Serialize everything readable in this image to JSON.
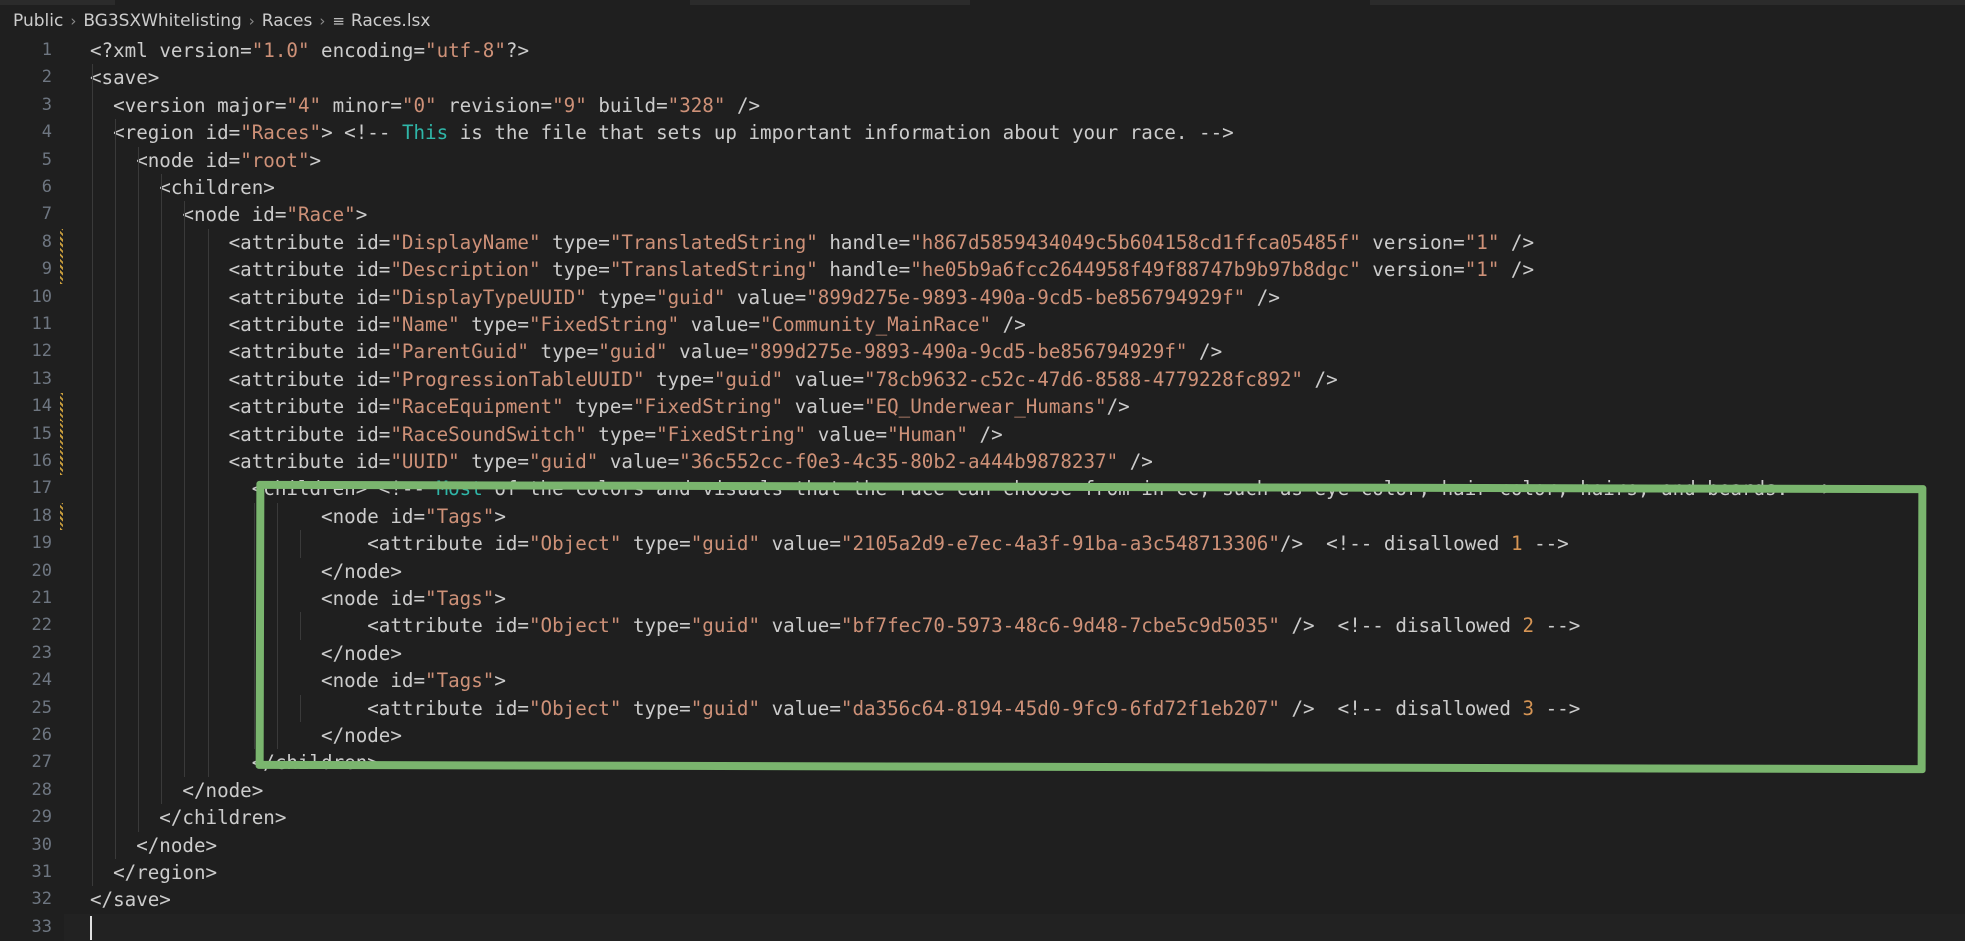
{
  "breadcrumb": {
    "items": [
      "Public",
      "BG3SXWhitelisting",
      "Races"
    ],
    "file": "Races.lsx"
  },
  "editor": {
    "lines": [
      [
        [
          "t-tag",
          "<?xml "
        ],
        [
          "t-attr",
          "version="
        ],
        [
          "t-str",
          "\"1.0\""
        ],
        [
          "t-attr",
          " encoding="
        ],
        [
          "t-str",
          "\"utf-8\""
        ],
        [
          "t-tag",
          "?>"
        ]
      ],
      [
        [
          "t-tag",
          "<save>"
        ]
      ],
      [
        [
          "t-tag",
          "  <version "
        ],
        [
          "t-attr",
          "major="
        ],
        [
          "t-str",
          "\"4\""
        ],
        [
          "t-attr",
          " minor="
        ],
        [
          "t-str",
          "\"0\""
        ],
        [
          "t-attr",
          " revision="
        ],
        [
          "t-str",
          "\"9\""
        ],
        [
          "t-attr",
          " build="
        ],
        [
          "t-str",
          "\"328\""
        ],
        [
          "t-tag",
          " />"
        ]
      ],
      [
        [
          "t-tag",
          "  <region "
        ],
        [
          "t-attr",
          "id="
        ],
        [
          "t-str",
          "\"Races\""
        ],
        [
          "t-tag",
          "> "
        ],
        [
          "t-cmtg",
          "<!-- "
        ],
        [
          "t-kw",
          "This"
        ],
        [
          "t-cmtg",
          " is the file that sets up important information about your race. -->"
        ]
      ],
      [
        [
          "t-tag",
          "    <node "
        ],
        [
          "t-attr",
          "id="
        ],
        [
          "t-str",
          "\"root\""
        ],
        [
          "t-tag",
          ">"
        ]
      ],
      [
        [
          "t-tag",
          "      <children>"
        ]
      ],
      [
        [
          "t-tag",
          "        <node "
        ],
        [
          "t-attr",
          "id="
        ],
        [
          "t-str",
          "\"Race\""
        ],
        [
          "t-tag",
          ">"
        ]
      ],
      [
        [
          "t-tag",
          "            <attribute "
        ],
        [
          "t-attr",
          "id="
        ],
        [
          "t-str",
          "\"DisplayName\""
        ],
        [
          "t-attr",
          " type="
        ],
        [
          "t-str",
          "\"TranslatedString\""
        ],
        [
          "t-attr",
          " handle="
        ],
        [
          "t-str",
          "\"h867d5859434049c5b604158cd1ffca05485f\""
        ],
        [
          "t-attr",
          " version="
        ],
        [
          "t-str",
          "\"1\""
        ],
        [
          "t-tag",
          " />"
        ]
      ],
      [
        [
          "t-tag",
          "            <attribute "
        ],
        [
          "t-attr",
          "id="
        ],
        [
          "t-str",
          "\"Description\""
        ],
        [
          "t-attr",
          " type="
        ],
        [
          "t-str",
          "\"TranslatedString\""
        ],
        [
          "t-attr",
          " handle="
        ],
        [
          "t-str",
          "\"he05b9a6fcc2644958f49f88747b9b97b8dgc\""
        ],
        [
          "t-attr",
          " version="
        ],
        [
          "t-str",
          "\"1\""
        ],
        [
          "t-tag",
          " />"
        ]
      ],
      [
        [
          "t-tag",
          "            <attribute "
        ],
        [
          "t-attr",
          "id="
        ],
        [
          "t-str",
          "\"DisplayTypeUUID\""
        ],
        [
          "t-attr",
          " type="
        ],
        [
          "t-str",
          "\"guid\""
        ],
        [
          "t-attr",
          " value="
        ],
        [
          "t-str",
          "\"899d275e-9893-490a-9cd5-be856794929f\""
        ],
        [
          "t-tag",
          " />"
        ]
      ],
      [
        [
          "t-tag",
          "            <attribute "
        ],
        [
          "t-attr",
          "id="
        ],
        [
          "t-str",
          "\"Name\""
        ],
        [
          "t-attr",
          " type="
        ],
        [
          "t-str",
          "\"FixedString\""
        ],
        [
          "t-attr",
          " value="
        ],
        [
          "t-str",
          "\"Community_MainRace\""
        ],
        [
          "t-tag",
          " />"
        ]
      ],
      [
        [
          "t-tag",
          "            <attribute "
        ],
        [
          "t-attr",
          "id="
        ],
        [
          "t-str",
          "\"ParentGuid\""
        ],
        [
          "t-attr",
          " type="
        ],
        [
          "t-str",
          "\"guid\""
        ],
        [
          "t-attr",
          " value="
        ],
        [
          "t-str",
          "\"899d275e-9893-490a-9cd5-be856794929f\""
        ],
        [
          "t-tag",
          " />"
        ]
      ],
      [
        [
          "t-tag",
          "            <attribute "
        ],
        [
          "t-attr",
          "id="
        ],
        [
          "t-str",
          "\"ProgressionTableUUID\""
        ],
        [
          "t-attr",
          " type="
        ],
        [
          "t-str",
          "\"guid\""
        ],
        [
          "t-attr",
          " value="
        ],
        [
          "t-str",
          "\"78cb9632-c52c-47d6-8588-4779228fc892\""
        ],
        [
          "t-tag",
          " />"
        ]
      ],
      [
        [
          "t-tag",
          "            <attribute "
        ],
        [
          "t-attr",
          "id="
        ],
        [
          "t-str",
          "\"RaceEquipment\""
        ],
        [
          "t-attr",
          " type="
        ],
        [
          "t-str",
          "\"FixedString\""
        ],
        [
          "t-attr",
          " value="
        ],
        [
          "t-str",
          "\"EQ_Underwear_Humans\""
        ],
        [
          "t-tag",
          "/>"
        ]
      ],
      [
        [
          "t-tag",
          "            <attribute "
        ],
        [
          "t-attr",
          "id="
        ],
        [
          "t-str",
          "\"RaceSoundSwitch\""
        ],
        [
          "t-attr",
          " type="
        ],
        [
          "t-str",
          "\"FixedString\""
        ],
        [
          "t-attr",
          " value="
        ],
        [
          "t-str",
          "\"Human\""
        ],
        [
          "t-tag",
          " />"
        ]
      ],
      [
        [
          "t-tag",
          "            <attribute "
        ],
        [
          "t-attr",
          "id="
        ],
        [
          "t-str",
          "\"UUID\""
        ],
        [
          "t-attr",
          " type="
        ],
        [
          "t-str",
          "\"guid\""
        ],
        [
          "t-attr",
          " value="
        ],
        [
          "t-str",
          "\"36c552cc-f0e3-4c35-80b2-a444b9878237\""
        ],
        [
          "t-tag",
          " />"
        ]
      ],
      [
        [
          "t-tag",
          "              <children> "
        ],
        [
          "t-cmtg",
          "<!-- "
        ],
        [
          "t-kw",
          "Most"
        ],
        [
          "t-cmtg",
          " of the colors and visuals that the race can choose from in cc, such as eye color, hair color, hairs, and beards. -->"
        ]
      ],
      [
        [
          "t-tag",
          "                    <node "
        ],
        [
          "t-attr",
          "id="
        ],
        [
          "t-str",
          "\"Tags\""
        ],
        [
          "t-tag",
          ">"
        ]
      ],
      [
        [
          "t-tag",
          "                        <attribute "
        ],
        [
          "t-attr",
          "id="
        ],
        [
          "t-str",
          "\"Object\""
        ],
        [
          "t-attr",
          " type="
        ],
        [
          "t-str",
          "\"guid\""
        ],
        [
          "t-attr",
          " value="
        ],
        [
          "t-str",
          "\"2105a2d9-e7ec-4a3f-91ba-a3c548713306\""
        ],
        [
          "t-tag",
          "/>  "
        ],
        [
          "t-cmtg",
          "<!-- disallowed "
        ],
        [
          "t-num",
          "1"
        ],
        [
          "t-cmtg",
          " -->"
        ]
      ],
      [
        [
          "t-tag",
          "                    </node>"
        ]
      ],
      [
        [
          "t-tag",
          "                    <node "
        ],
        [
          "t-attr",
          "id="
        ],
        [
          "t-str",
          "\"Tags\""
        ],
        [
          "t-tag",
          ">"
        ]
      ],
      [
        [
          "t-tag",
          "                        <attribute "
        ],
        [
          "t-attr",
          "id="
        ],
        [
          "t-str",
          "\"Object\""
        ],
        [
          "t-attr",
          " type="
        ],
        [
          "t-str",
          "\"guid\""
        ],
        [
          "t-attr",
          " value="
        ],
        [
          "t-str",
          "\"bf7fec70-5973-48c6-9d48-7cbe5c9d5035\""
        ],
        [
          "t-tag",
          " />  "
        ],
        [
          "t-cmtg",
          "<!-- disallowed "
        ],
        [
          "t-num",
          "2"
        ],
        [
          "t-cmtg",
          " -->"
        ]
      ],
      [
        [
          "t-tag",
          "                    </node>"
        ]
      ],
      [
        [
          "t-tag",
          "                    <node "
        ],
        [
          "t-attr",
          "id="
        ],
        [
          "t-str",
          "\"Tags\""
        ],
        [
          "t-tag",
          ">"
        ]
      ],
      [
        [
          "t-tag",
          "                        <attribute "
        ],
        [
          "t-attr",
          "id="
        ],
        [
          "t-str",
          "\"Object\""
        ],
        [
          "t-attr",
          " type="
        ],
        [
          "t-str",
          "\"guid\""
        ],
        [
          "t-attr",
          " value="
        ],
        [
          "t-str",
          "\"da356c64-8194-45d0-9fc9-6fd72f1eb207\""
        ],
        [
          "t-tag",
          " />  "
        ],
        [
          "t-cmtg",
          "<!-- disallowed "
        ],
        [
          "t-num",
          "3"
        ],
        [
          "t-cmtg",
          " -->"
        ]
      ],
      [
        [
          "t-tag",
          "                    </node>"
        ]
      ],
      [
        [
          "t-tag",
          "              </children>"
        ]
      ],
      [
        [
          "t-tag",
          "        </node>"
        ]
      ],
      [
        [
          "t-tag",
          "      </children>"
        ]
      ],
      [
        [
          "t-tag",
          "    </node>"
        ]
      ],
      [
        [
          "t-tag",
          "  </region>"
        ]
      ],
      [
        [
          "t-tag",
          "</save>"
        ]
      ],
      []
    ],
    "modified_lines": [
      8,
      9,
      14,
      15,
      16,
      18
    ]
  }
}
